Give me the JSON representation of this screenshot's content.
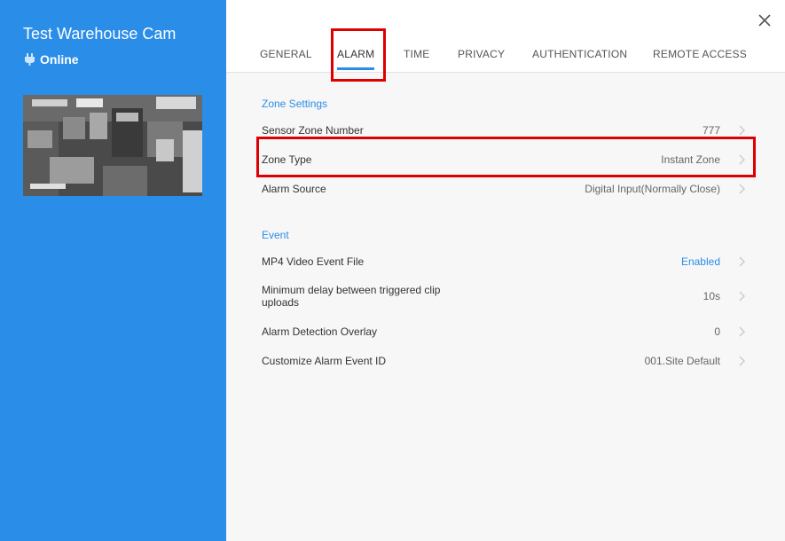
{
  "sidebar": {
    "camera_name": "Test Warehouse Cam",
    "status": "Online",
    "thumbnail_label": "warehouse camera snapshot"
  },
  "tabs": [
    {
      "label": "GENERAL"
    },
    {
      "label": "ALARM",
      "active": true
    },
    {
      "label": "TIME"
    },
    {
      "label": "PRIVACY"
    },
    {
      "label": "AUTHENTICATION"
    },
    {
      "label": "REMOTE ACCESS"
    }
  ],
  "zone_settings": {
    "title": "Zone Settings",
    "rows": [
      {
        "label": "Sensor Zone Number",
        "value": "777"
      },
      {
        "label": "Zone Type",
        "value": "Instant Zone"
      },
      {
        "label": "Alarm Source",
        "value": "Digital Input(Normally Close)"
      }
    ]
  },
  "event": {
    "title": "Event",
    "rows": [
      {
        "label": "MP4 Video Event File",
        "value": "Enabled"
      },
      {
        "label": "Minimum delay between triggered clip uploads",
        "value": "10s"
      },
      {
        "label": "Alarm Detection Overlay",
        "value": "0"
      },
      {
        "label": "Customize Alarm Event ID",
        "value": "001.Site Default"
      }
    ]
  },
  "colors": {
    "sidebar_bg": "#2a8de8",
    "accent": "#2a8de8",
    "highlight": "#dd0000"
  },
  "icons": {
    "close": "close-icon",
    "status": "plug-icon",
    "row_arrow": "chevron-right-icon"
  }
}
